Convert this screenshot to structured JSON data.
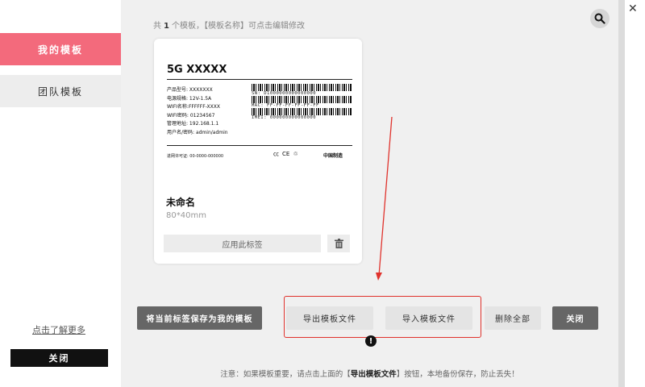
{
  "sidebar": {
    "tabs": [
      {
        "label": "我的模板",
        "active": true
      },
      {
        "label": "团队模板",
        "active": false
      }
    ],
    "learn_more": "点击了解更多",
    "close_label": "关闭"
  },
  "header": {
    "count_prefix": "共",
    "count_value": "1",
    "count_suffix": "个模板，【模板名称】可点击编辑修改",
    "search_icon": "search-icon"
  },
  "template_card": {
    "preview": {
      "title": "5G XXXXX",
      "lines": [
        "产品型号: XXXXXXX",
        "电源规格: 12V-1.5A",
        "WIFI名称:FFFFFF-XXXX",
        "WIFI密码: 01234567",
        "管理地址: 192.168.1.1",
        "用户名/密码: admin/admin"
      ],
      "barcodes": [
        "SN: D1000000000000000",
        "MAC: FF-FF-FF-FF-FF-FF",
        "IMEI: 000000000000000"
      ],
      "license": "进网许可证: 00-0000-000000",
      "certs": [
        "㏄",
        "CE",
        "♲"
      ],
      "made_in": "中国制造"
    },
    "name": "未命名",
    "size": "80*40mm",
    "apply_label": "应用此标签",
    "trash_icon": "trash-icon"
  },
  "actions": {
    "save_current": "将当前标签保存为我的模板",
    "export": "导出模板文件",
    "import": "导入模板文件",
    "delete_all": "删除全部",
    "close": "关闭"
  },
  "note": {
    "prefix": "注意：如果模板重要，请点击上面的【",
    "emphasis": "导出模板文件",
    "suffix": "】按钮，本地备份保存，防止丢失！"
  },
  "window": {
    "close_icon": "close-icon",
    "close_glyph": "✕"
  },
  "colors": {
    "accent": "#f36a7c",
    "annotation": "#e0322c"
  }
}
